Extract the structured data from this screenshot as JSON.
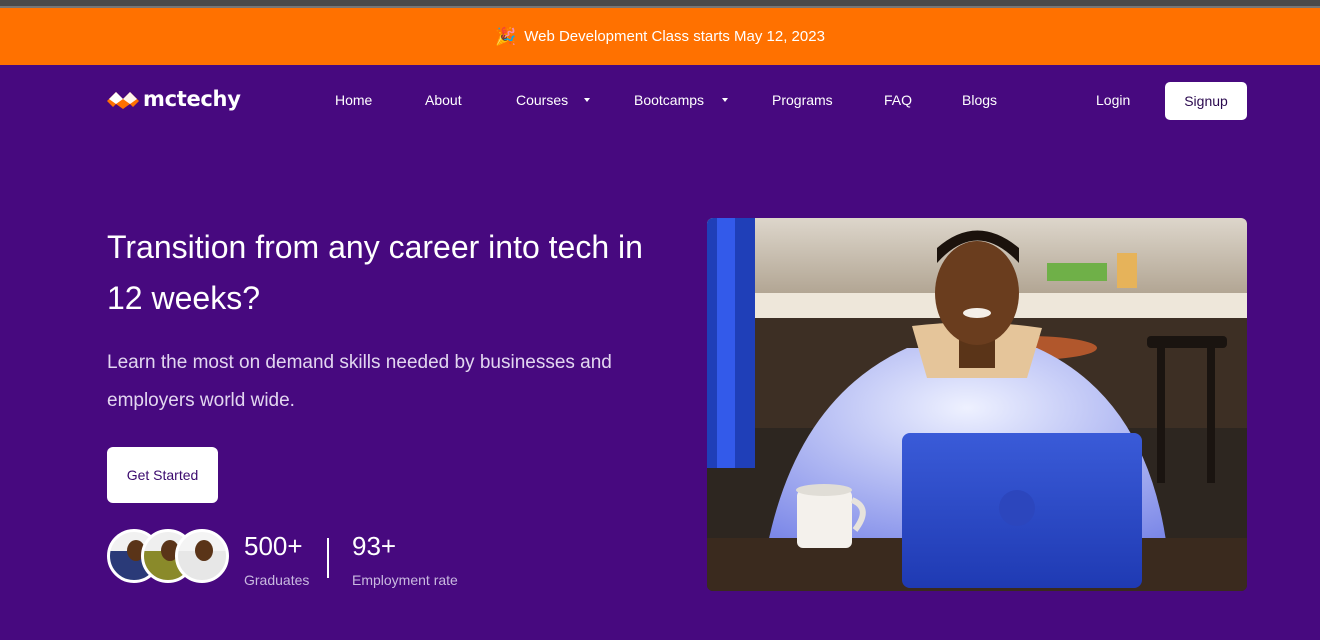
{
  "announcement": {
    "icon": "party-popper-icon",
    "text": "Web Development Class starts May 12, 2023"
  },
  "brand": {
    "name": "mctechy",
    "accent": "#ff7100",
    "background": "#47097f"
  },
  "nav": {
    "links": [
      "Home",
      "About",
      "Courses",
      "Bootcamps",
      "Programs",
      "FAQ",
      "Blogs"
    ],
    "login": "Login",
    "signup": "Signup"
  },
  "hero": {
    "title": "Transition from any career into tech in 12 weeks?",
    "subtitle": "Learn the most on demand skills needed by businesses and employers world wide.",
    "cta": "Get Started"
  },
  "stats": [
    {
      "value": "500+",
      "label": "Graduates"
    },
    {
      "value": "93+",
      "label": "Employment rate"
    }
  ]
}
